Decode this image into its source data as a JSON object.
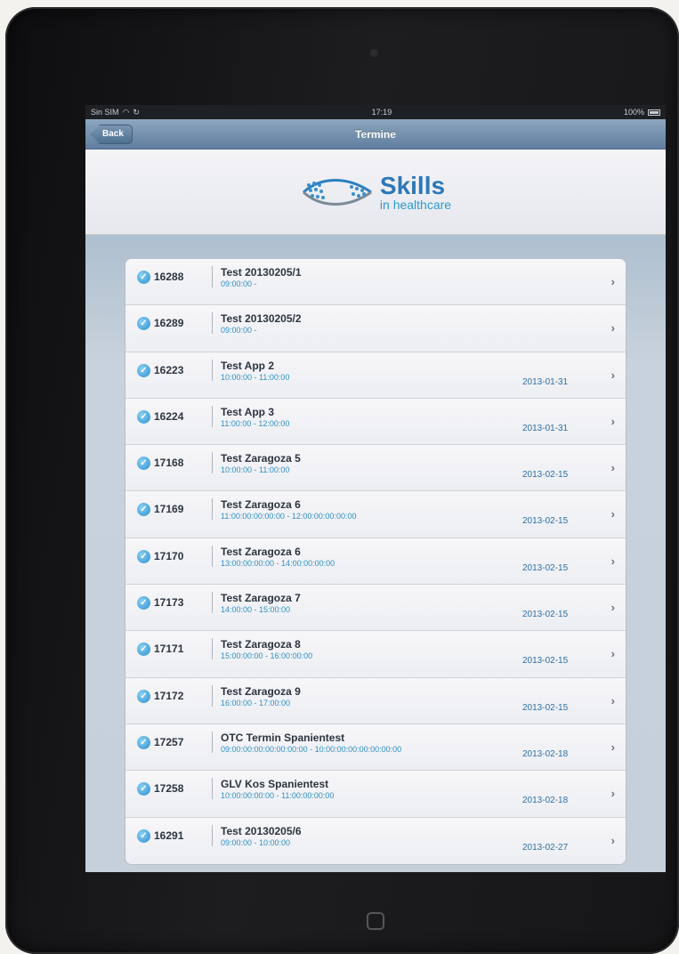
{
  "status_bar": {
    "carrier": "Sin SIM",
    "time": "17:19",
    "battery": "100%"
  },
  "nav": {
    "back_label": "Back",
    "title": "Termine"
  },
  "logo": {
    "title": "Skills",
    "subtitle": "in healthcare"
  },
  "appointments": [
    {
      "id": "16288",
      "title": "Test 20130205/1",
      "time": "09:00:00 -",
      "date": ""
    },
    {
      "id": "16289",
      "title": "Test 20130205/2",
      "time": "09:00:00 -",
      "date": ""
    },
    {
      "id": "16223",
      "title": "Test App 2",
      "time": "10:00:00 - 11:00:00",
      "date": "2013-01-31"
    },
    {
      "id": "16224",
      "title": "Test App 3",
      "time": "11:00:00 - 12:00:00",
      "date": "2013-01-31"
    },
    {
      "id": "17168",
      "title": "Test Zaragoza 5",
      "time": "10:00:00 - 11:00:00",
      "date": "2013-02-15"
    },
    {
      "id": "17169",
      "title": "Test Zaragoza 6",
      "time": "11:00:00:00:00:00 - 12:00:00:00:00:00",
      "date": "2013-02-15"
    },
    {
      "id": "17170",
      "title": "Test Zaragoza 6",
      "time": "13:00:00:00:00 - 14:00:00:00:00",
      "date": "2013-02-15"
    },
    {
      "id": "17173",
      "title": "Test Zaragoza 7",
      "time": "14:00:00 - 15:00:00",
      "date": "2013-02-15"
    },
    {
      "id": "17171",
      "title": "Test Zaragoza 8",
      "time": "15:00:00:00 - 16:00:00:00",
      "date": "2013-02-15"
    },
    {
      "id": "17172",
      "title": "Test Zaragoza 9",
      "time": "16:00:00 - 17:00:00",
      "date": "2013-02-15"
    },
    {
      "id": "17257",
      "title": "OTC Termin Spanientest",
      "time": "09:00:00:00:00:00:00:00 - 10:00:00:00:00:00:00:00",
      "date": "2013-02-18"
    },
    {
      "id": "17258",
      "title": "GLV Kos Spanientest",
      "time": "10:00:00:00:00 - 11:00:00:00:00",
      "date": "2013-02-18"
    },
    {
      "id": "16291",
      "title": "Test 20130205/6",
      "time": "09:00:00 - 10:00:00",
      "date": "2013-02-27"
    }
  ]
}
